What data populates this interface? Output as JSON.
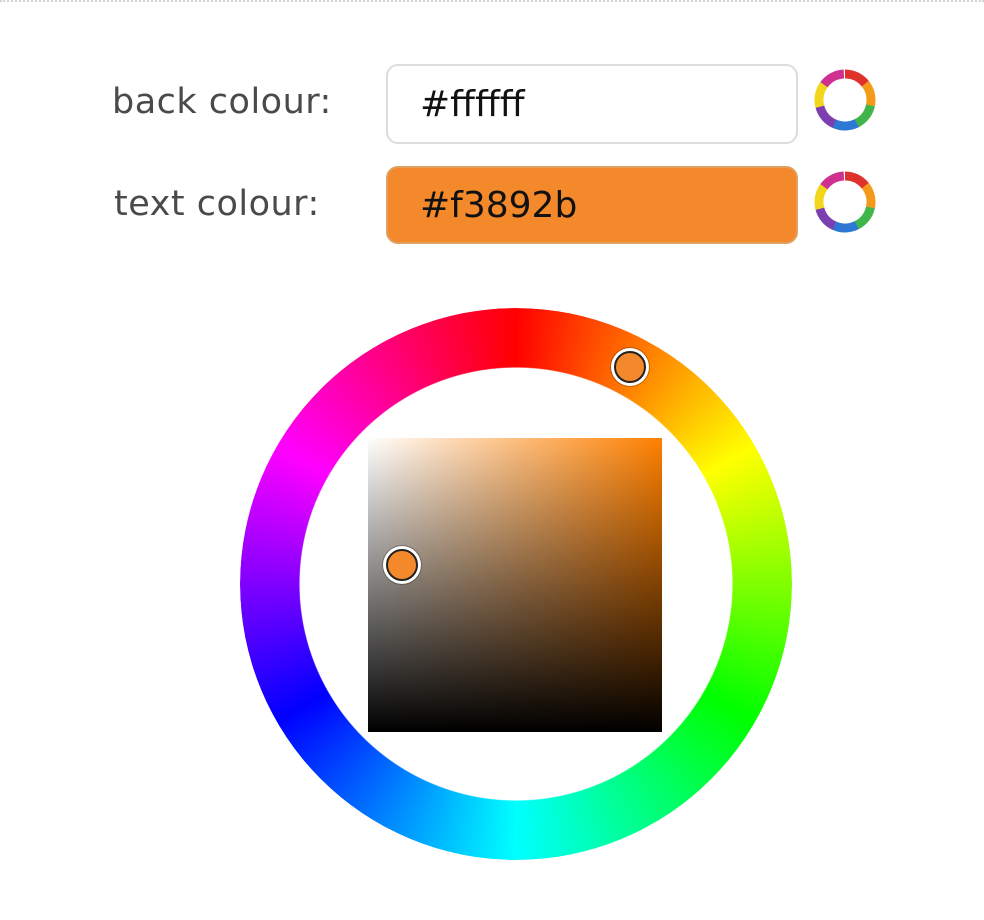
{
  "fields": {
    "back": {
      "label": "back colour:",
      "value": "#ffffff",
      "color": "#ffffff"
    },
    "text": {
      "label": "text colour:",
      "value": "#f3892b",
      "color": "#f3892b"
    }
  },
  "icons": {
    "wheel_button": "colour-wheel-icon",
    "wheel_segments": [
      "#e0322d",
      "#f39a1b",
      "#f2d61a",
      "#3fb54a",
      "#2d78d2",
      "#7b3fb0",
      "#d0308f"
    ]
  },
  "picker": {
    "hue_color": "#ff8000",
    "selected_color": "#f3892b"
  }
}
